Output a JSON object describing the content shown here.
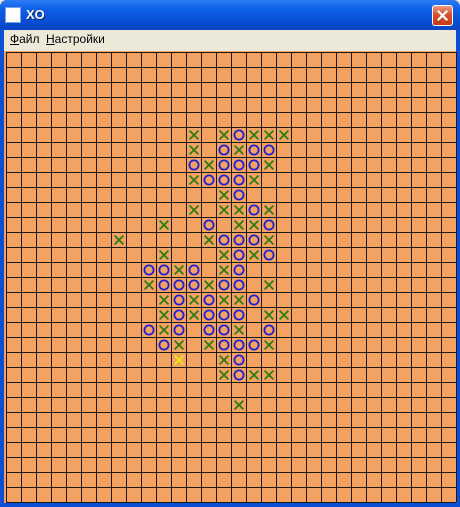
{
  "window": {
    "title": "XO"
  },
  "menu": {
    "file_first": "Ф",
    "file_rest": "айл",
    "settings_first": "Н",
    "settings_rest": "астройки"
  },
  "board": {
    "cols": 30,
    "rows": 30,
    "background": "#f4a261",
    "line_color": "#1a1a1a",
    "x_color": "#2e7d12",
    "o_color": "#1f1fd6",
    "last_move_color": "#e8e80c",
    "moves": [
      {
        "row": 5,
        "col": 12,
        "mark": "X"
      },
      {
        "row": 5,
        "col": 14,
        "mark": "X"
      },
      {
        "row": 5,
        "col": 15,
        "mark": "O"
      },
      {
        "row": 5,
        "col": 16,
        "mark": "X"
      },
      {
        "row": 5,
        "col": 17,
        "mark": "X"
      },
      {
        "row": 5,
        "col": 18,
        "mark": "X"
      },
      {
        "row": 6,
        "col": 12,
        "mark": "X"
      },
      {
        "row": 6,
        "col": 14,
        "mark": "O"
      },
      {
        "row": 6,
        "col": 15,
        "mark": "X"
      },
      {
        "row": 6,
        "col": 16,
        "mark": "O"
      },
      {
        "row": 6,
        "col": 17,
        "mark": "O"
      },
      {
        "row": 7,
        "col": 12,
        "mark": "O"
      },
      {
        "row": 7,
        "col": 13,
        "mark": "X"
      },
      {
        "row": 7,
        "col": 14,
        "mark": "O"
      },
      {
        "row": 7,
        "col": 15,
        "mark": "O"
      },
      {
        "row": 7,
        "col": 16,
        "mark": "O"
      },
      {
        "row": 7,
        "col": 17,
        "mark": "X"
      },
      {
        "row": 8,
        "col": 12,
        "mark": "X"
      },
      {
        "row": 8,
        "col": 13,
        "mark": "O"
      },
      {
        "row": 8,
        "col": 14,
        "mark": "O"
      },
      {
        "row": 8,
        "col": 15,
        "mark": "O"
      },
      {
        "row": 8,
        "col": 16,
        "mark": "X"
      },
      {
        "row": 9,
        "col": 14,
        "mark": "X"
      },
      {
        "row": 9,
        "col": 15,
        "mark": "O"
      },
      {
        "row": 10,
        "col": 12,
        "mark": "X"
      },
      {
        "row": 10,
        "col": 14,
        "mark": "X"
      },
      {
        "row": 10,
        "col": 15,
        "mark": "X"
      },
      {
        "row": 10,
        "col": 16,
        "mark": "O"
      },
      {
        "row": 10,
        "col": 17,
        "mark": "X"
      },
      {
        "row": 11,
        "col": 10,
        "mark": "X"
      },
      {
        "row": 11,
        "col": 13,
        "mark": "O"
      },
      {
        "row": 11,
        "col": 15,
        "mark": "X"
      },
      {
        "row": 11,
        "col": 16,
        "mark": "X"
      },
      {
        "row": 11,
        "col": 17,
        "mark": "O"
      },
      {
        "row": 12,
        "col": 7,
        "mark": "X"
      },
      {
        "row": 12,
        "col": 13,
        "mark": "X"
      },
      {
        "row": 12,
        "col": 14,
        "mark": "O"
      },
      {
        "row": 12,
        "col": 15,
        "mark": "O"
      },
      {
        "row": 12,
        "col": 16,
        "mark": "O"
      },
      {
        "row": 12,
        "col": 17,
        "mark": "X"
      },
      {
        "row": 13,
        "col": 10,
        "mark": "X"
      },
      {
        "row": 13,
        "col": 14,
        "mark": "X"
      },
      {
        "row": 13,
        "col": 15,
        "mark": "O"
      },
      {
        "row": 13,
        "col": 16,
        "mark": "X"
      },
      {
        "row": 13,
        "col": 17,
        "mark": "O"
      },
      {
        "row": 14,
        "col": 9,
        "mark": "O"
      },
      {
        "row": 14,
        "col": 10,
        "mark": "O"
      },
      {
        "row": 14,
        "col": 11,
        "mark": "X"
      },
      {
        "row": 14,
        "col": 12,
        "mark": "O"
      },
      {
        "row": 14,
        "col": 14,
        "mark": "X"
      },
      {
        "row": 14,
        "col": 15,
        "mark": "O"
      },
      {
        "row": 15,
        "col": 9,
        "mark": "X"
      },
      {
        "row": 15,
        "col": 10,
        "mark": "O"
      },
      {
        "row": 15,
        "col": 11,
        "mark": "O"
      },
      {
        "row": 15,
        "col": 12,
        "mark": "O"
      },
      {
        "row": 15,
        "col": 13,
        "mark": "X"
      },
      {
        "row": 15,
        "col": 14,
        "mark": "O"
      },
      {
        "row": 15,
        "col": 15,
        "mark": "O"
      },
      {
        "row": 15,
        "col": 17,
        "mark": "X"
      },
      {
        "row": 16,
        "col": 10,
        "mark": "X"
      },
      {
        "row": 16,
        "col": 11,
        "mark": "O"
      },
      {
        "row": 16,
        "col": 12,
        "mark": "X"
      },
      {
        "row": 16,
        "col": 13,
        "mark": "O"
      },
      {
        "row": 16,
        "col": 14,
        "mark": "X"
      },
      {
        "row": 16,
        "col": 15,
        "mark": "X"
      },
      {
        "row": 16,
        "col": 16,
        "mark": "O"
      },
      {
        "row": 17,
        "col": 10,
        "mark": "X"
      },
      {
        "row": 17,
        "col": 11,
        "mark": "O"
      },
      {
        "row": 17,
        "col": 12,
        "mark": "X"
      },
      {
        "row": 17,
        "col": 13,
        "mark": "O"
      },
      {
        "row": 17,
        "col": 14,
        "mark": "O"
      },
      {
        "row": 17,
        "col": 15,
        "mark": "O"
      },
      {
        "row": 17,
        "col": 17,
        "mark": "X"
      },
      {
        "row": 17,
        "col": 18,
        "mark": "X"
      },
      {
        "row": 18,
        "col": 9,
        "mark": "O"
      },
      {
        "row": 18,
        "col": 10,
        "mark": "X"
      },
      {
        "row": 18,
        "col": 11,
        "mark": "O"
      },
      {
        "row": 18,
        "col": 13,
        "mark": "O"
      },
      {
        "row": 18,
        "col": 14,
        "mark": "O"
      },
      {
        "row": 18,
        "col": 15,
        "mark": "X"
      },
      {
        "row": 18,
        "col": 17,
        "mark": "O"
      },
      {
        "row": 19,
        "col": 10,
        "mark": "O"
      },
      {
        "row": 19,
        "col": 11,
        "mark": "X"
      },
      {
        "row": 19,
        "col": 13,
        "mark": "X"
      },
      {
        "row": 19,
        "col": 14,
        "mark": "O"
      },
      {
        "row": 19,
        "col": 15,
        "mark": "O"
      },
      {
        "row": 19,
        "col": 16,
        "mark": "O"
      },
      {
        "row": 19,
        "col": 17,
        "mark": "X"
      },
      {
        "row": 20,
        "col": 11,
        "mark": "X",
        "last": true
      },
      {
        "row": 20,
        "col": 14,
        "mark": "X"
      },
      {
        "row": 20,
        "col": 15,
        "mark": "O"
      },
      {
        "row": 21,
        "col": 14,
        "mark": "X"
      },
      {
        "row": 21,
        "col": 15,
        "mark": "O"
      },
      {
        "row": 21,
        "col": 16,
        "mark": "X"
      },
      {
        "row": 21,
        "col": 17,
        "mark": "X"
      },
      {
        "row": 23,
        "col": 15,
        "mark": "X"
      }
    ]
  }
}
